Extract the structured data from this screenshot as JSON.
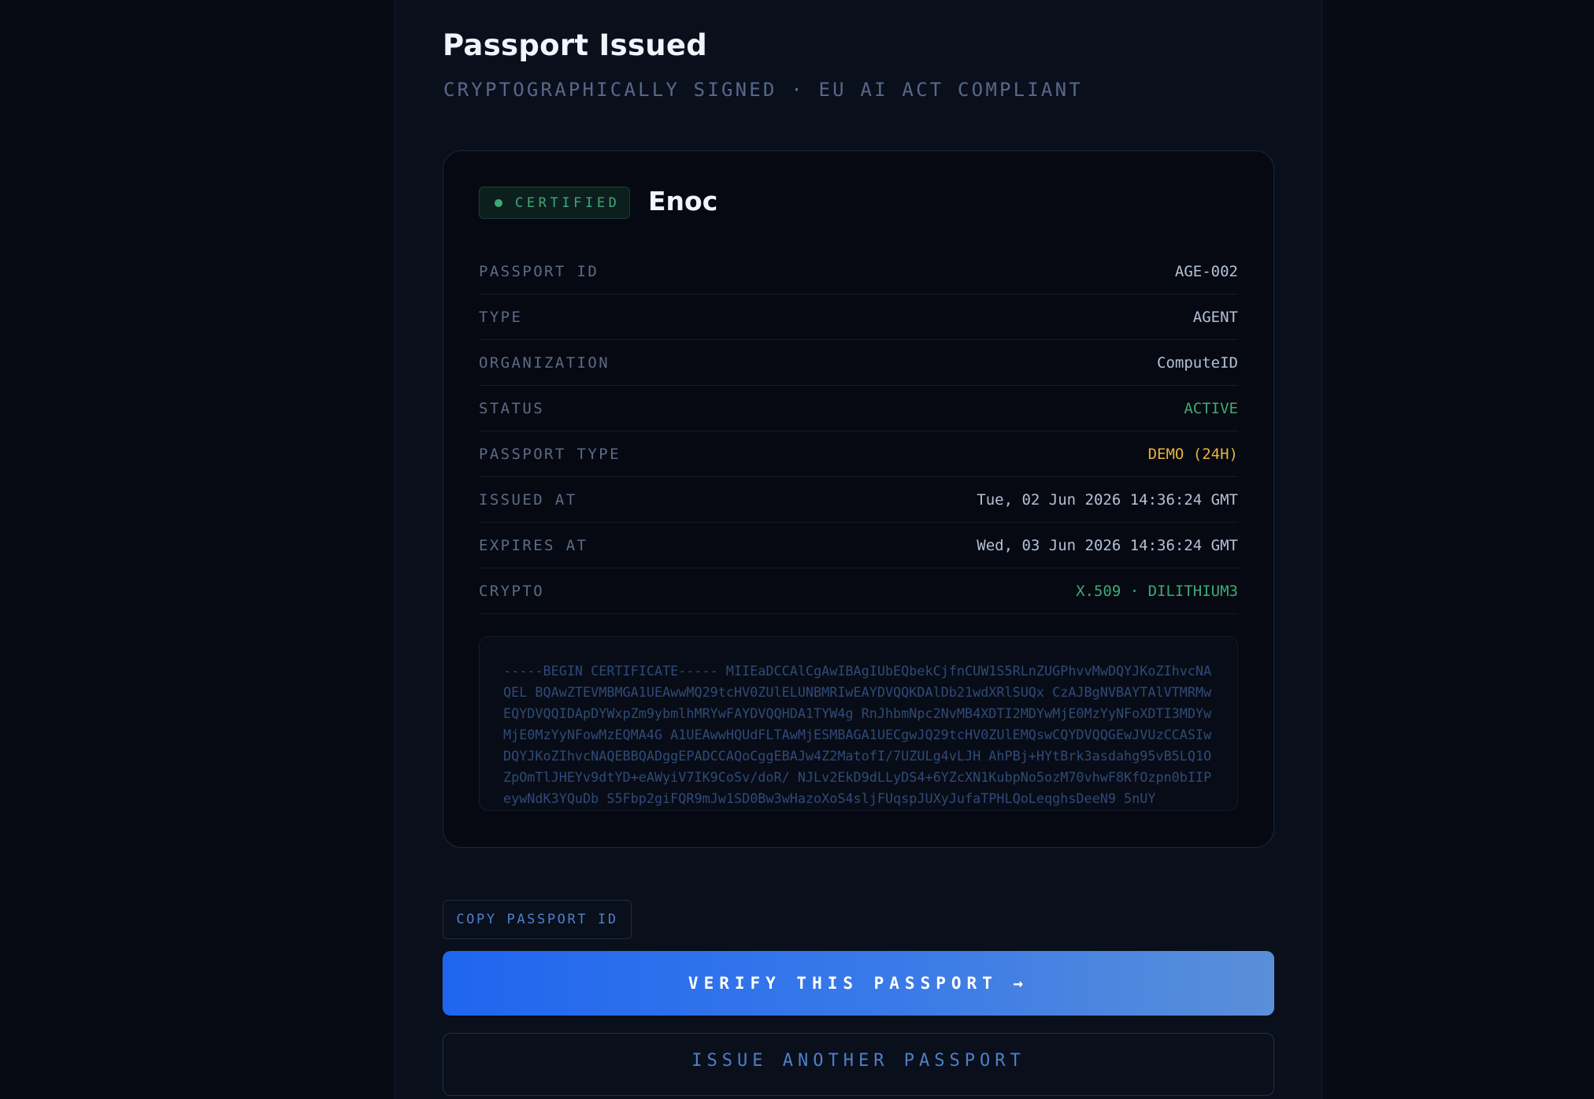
{
  "header": {
    "title": "Passport Issued",
    "subtitle": "CRYPTOGRAPHICALLY SIGNED · EU AI ACT COMPLIANT"
  },
  "card": {
    "badge_label": "CERTIFIED",
    "agent_name": "Enoc",
    "fields": [
      {
        "label": "PASSPORT ID",
        "value": "AGE-002",
        "color": "#b4c0d6"
      },
      {
        "label": "TYPE",
        "value": "AGENT",
        "color": "#b4c0d6"
      },
      {
        "label": "ORGANIZATION",
        "value": "ComputeID",
        "color": "#b4c0d6"
      },
      {
        "label": "STATUS",
        "value": "ACTIVE",
        "color": "#3fa876"
      },
      {
        "label": "PASSPORT TYPE",
        "value": "DEMO (24H)",
        "color": "#e8b33f"
      },
      {
        "label": "ISSUED AT",
        "value": "Tue, 02 Jun 2026 14:36:24 GMT",
        "color": "#b4c0d6"
      },
      {
        "label": "EXPIRES AT",
        "value": "Wed, 03 Jun 2026 14:36:24 GMT",
        "color": "#b4c0d6"
      },
      {
        "label": "CRYPTO",
        "value": "X.509 · DILITHIUM3",
        "color": "#3fa876"
      }
    ],
    "certificate": "-----BEGIN CERTIFICATE----- MIIEaDCCAlCgAwIBAgIUbEQbekCjfnCUW1S5RLnZUGPhvvMwDQYJKoZIhvcNAQEL BQAwZTEVMBMGA1UEAwwMQ29tcHV0ZUlELUNBMRIwEAYDVQQKDAlDb21wdXRlSUQx CzAJBgNVBAYTAlVTMRMwEQYDVQQIDApDYWxpZm9ybmlhMRYwFAYDVQQHDA1TYW4g RnJhbmNpc2NvMB4XDTI2MDYwMjE0MzYyNFoXDTI3MDYwMjE0MzYyNFowMzEQMA4G A1UEAwwHQUdFLTAwMjESMBAGA1UECgwJQ29tcHV0ZUlEMQswCQYDVQQGEwJVUzCCASIwDQYJKoZIhvcNAQEBBQADggEPADCCAQoCggEBAJw4Z2MatofI/7UZULg4vLJH AhPBj+HYtBrk3asdahg95vB5LQ1OZpOmTlJHEYv9dtYD+eAWyiV7IK9CoSv/doR/ NJLv2EkD9dLLyDS4+6YZcXN1KubpNo5ozM70vhwF8KfOzpn0bIIPeywNdK3YQuDb S5Fbp2giFQR9mJw1SD0Bw3wHazoXoS4sljFUqspJUXyJufaTPHLQoLeqghsDeeN9 5nUY"
  },
  "actions": {
    "copy_label": "COPY PASSPORT ID",
    "verify_label": "VERIFY THIS PASSPORT →",
    "issue_label": "ISSUE ANOTHER PASSPORT"
  }
}
